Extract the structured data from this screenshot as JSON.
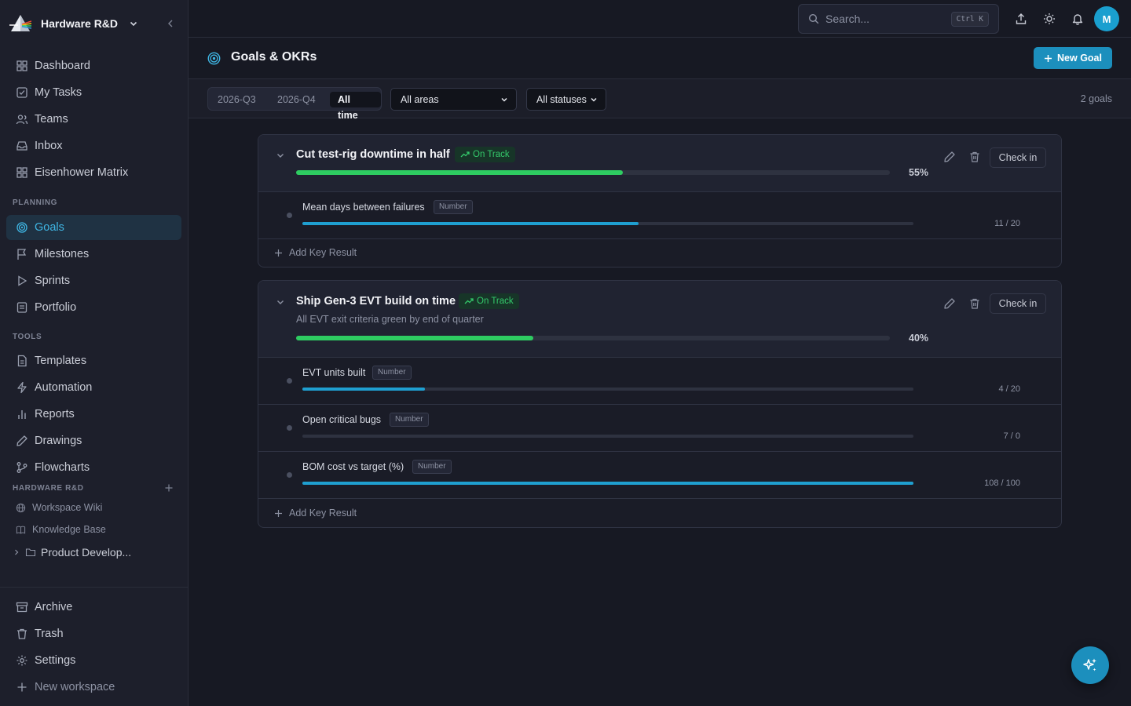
{
  "workspace": {
    "name": "Hardware R&D"
  },
  "nav": {
    "main": [
      {
        "label": "Dashboard",
        "icon": "dashboard-icon"
      },
      {
        "label": "My Tasks",
        "icon": "tasks-icon"
      },
      {
        "label": "Teams",
        "icon": "teams-icon"
      },
      {
        "label": "Inbox",
        "icon": "inbox-icon"
      },
      {
        "label": "Eisenhower Matrix",
        "icon": "matrix-icon"
      }
    ],
    "planning_label": "PLANNING",
    "planning": [
      {
        "label": "Goals",
        "icon": "target-icon",
        "active": true
      },
      {
        "label": "Milestones",
        "icon": "flag-icon"
      },
      {
        "label": "Sprints",
        "icon": "play-icon"
      },
      {
        "label": "Portfolio",
        "icon": "portfolio-icon"
      }
    ],
    "tools_label": "TOOLS",
    "tools": [
      {
        "label": "Templates",
        "icon": "template-icon"
      },
      {
        "label": "Automation",
        "icon": "bolt-icon"
      },
      {
        "label": "Reports",
        "icon": "bar-chart-icon"
      },
      {
        "label": "Drawings",
        "icon": "pen-icon"
      },
      {
        "label": "Flowcharts",
        "icon": "flowchart-icon"
      }
    ],
    "workspace_label": "HARDWARE R&D",
    "workspace_items": [
      {
        "label": "Workspace Wiki",
        "icon": "globe-icon"
      },
      {
        "label": "Knowledge Base",
        "icon": "book-icon"
      }
    ],
    "folder": {
      "label": "Product Develop..."
    },
    "bottom": [
      {
        "label": "Archive",
        "icon": "archive-icon"
      },
      {
        "label": "Trash",
        "icon": "trash-icon"
      },
      {
        "label": "Settings",
        "icon": "gear-icon"
      },
      {
        "label": "New workspace",
        "icon": "plus-icon"
      }
    ]
  },
  "topbar": {
    "search_placeholder": "Search...",
    "shortcut": "Ctrl K",
    "avatar_initial": "M"
  },
  "page": {
    "title": "Goals & OKRs",
    "new_goal_label": "New Goal"
  },
  "filters": {
    "periods": [
      "2026-Q3",
      "2026-Q4",
      "All time"
    ],
    "active_period": "All time",
    "area": "All areas",
    "status": "All statuses",
    "count": "2 goals"
  },
  "colors": {
    "accent": "#1c8fbd",
    "on_track": "#34c96b",
    "kr_bar": "#1f9fd0"
  },
  "goals": [
    {
      "title": "Cut test-rig downtime in half",
      "status": "On Track",
      "description": "",
      "progress": 55,
      "progress_label": "55%",
      "checkin_label": "Check in",
      "add_kr_label": "Add Key Result",
      "key_results": [
        {
          "name": "Mean days between failures",
          "type": "Number",
          "current": 11,
          "target": 20,
          "value_label": "11 / 20",
          "progress": 0.55
        }
      ]
    },
    {
      "title": "Ship Gen-3 EVT build on time",
      "status": "On Track",
      "description": "All EVT exit criteria green by end of quarter",
      "progress": 40,
      "progress_label": "40%",
      "checkin_label": "Check in",
      "add_kr_label": "Add Key Result",
      "key_results": [
        {
          "name": "EVT units built",
          "type": "Number",
          "current": 4,
          "target": 20,
          "value_label": "4 / 20",
          "progress": 0.2
        },
        {
          "name": "Open critical bugs",
          "type": "Number",
          "current": 7,
          "target": 0,
          "value_label": "7 / 0",
          "progress": 0
        },
        {
          "name": "BOM cost vs target (%)",
          "type": "Number",
          "current": 108,
          "target": 100,
          "value_label": "108 / 100",
          "progress": 1.0
        }
      ]
    }
  ]
}
